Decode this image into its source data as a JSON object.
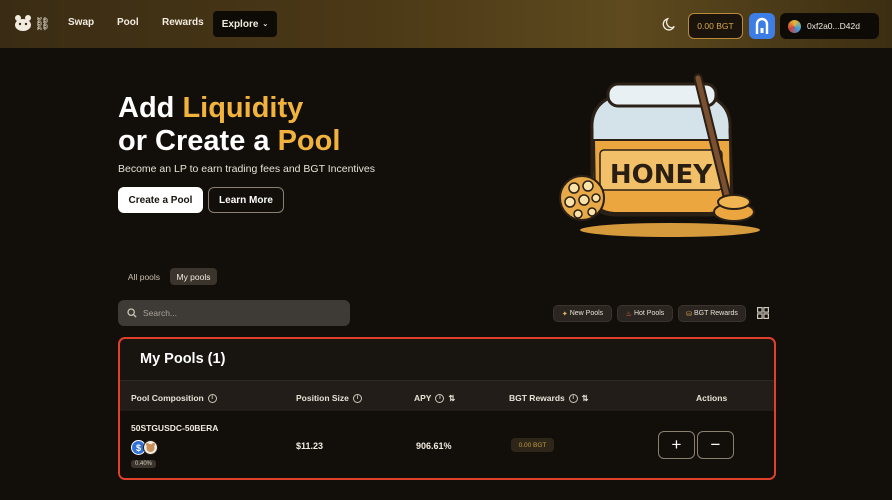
{
  "nav": {
    "links": [
      "Swap",
      "Pool",
      "Rewards"
    ],
    "explore_label": "Explore",
    "bgt_balance": "0.00 BGT",
    "wallet_address": "0xf2a0...D42d"
  },
  "hero": {
    "title_line1_plain": "Add ",
    "title_line1_gold": "Liquidity",
    "title_line2_plain": "or Create a ",
    "title_line2_gold": "Pool",
    "subtitle": "Become an LP to earn trading fees and BGT Incentives",
    "create_label": "Create a Pool",
    "learn_label": "Learn More",
    "jar_text": "HONEY"
  },
  "tabs": {
    "all": "All pools",
    "my": "My pools"
  },
  "search": {
    "placeholder": "Search..."
  },
  "filters": {
    "new": "New Pools",
    "hot": "Hot Pools",
    "bgt": "BGT Rewards"
  },
  "panel": {
    "title": "My Pools (1)",
    "columns": {
      "composition": "Pool Composition",
      "position": "Position Size",
      "apy": "APY",
      "bgt": "BGT Rewards",
      "actions": "Actions"
    },
    "rows": [
      {
        "name": "50STGUSDC-50BERA",
        "fee": "0.40%",
        "position": "$11.23",
        "apy": "906.61%",
        "bgt": "0.00 BGT"
      }
    ]
  },
  "colors": {
    "accent_gold": "#f2b33d",
    "highlight_border": "#e0402a",
    "token_usdc": "#2f6fd6"
  }
}
